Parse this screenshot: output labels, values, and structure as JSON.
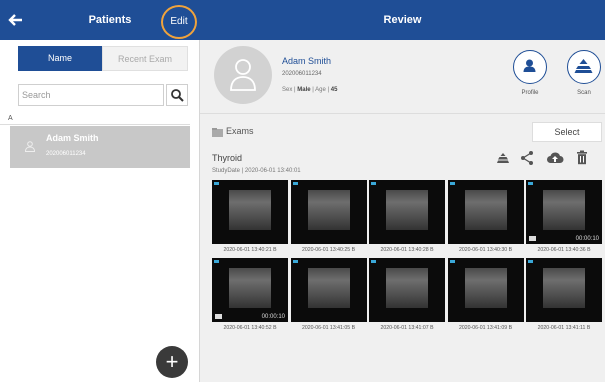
{
  "topbar": {
    "left_title": "Patients",
    "edit_label": "Edit",
    "right_title": "Review"
  },
  "left": {
    "tabs": [
      {
        "label": "Name",
        "active": true
      },
      {
        "label": "Recent Exam",
        "active": false
      }
    ],
    "search_placeholder": "Search",
    "group_letter": "A",
    "patients": [
      {
        "name": "Adam Smith",
        "id": "202006011234",
        "selected": true
      }
    ]
  },
  "patient": {
    "name": "Adam Smith",
    "id": "202006011234",
    "sex_label": "Sex",
    "sex": "Male",
    "age_label": "Age",
    "age": "45",
    "profile_label": "Profile",
    "scan_label": "Scan"
  },
  "exams": {
    "label": "Exams",
    "select_label": "Select",
    "study_title": "Thyroid",
    "study_date": "StudyDate | 2020-06-01 13:40:01",
    "images": [
      {
        "caption": "2020-06-01 13:40:21 B",
        "video": false,
        "duration": ""
      },
      {
        "caption": "2020-06-01 13:40:25 B",
        "video": false,
        "duration": ""
      },
      {
        "caption": "2020-06-01 13:40:28 B",
        "video": false,
        "duration": ""
      },
      {
        "caption": "2020-06-01 13:40:30 B",
        "video": false,
        "duration": ""
      },
      {
        "caption": "2020-06-01 13:40:36 B",
        "video": true,
        "duration": "00:00:10"
      },
      {
        "caption": "2020-06-01 13:40:52 B",
        "video": true,
        "duration": "00:00:10"
      },
      {
        "caption": "2020-06-01 13:41:05 B",
        "video": false,
        "duration": ""
      },
      {
        "caption": "2020-06-01 13:41:07 B",
        "video": false,
        "duration": ""
      },
      {
        "caption": "2020-06-01 13:41:09 B",
        "video": false,
        "duration": ""
      },
      {
        "caption": "2020-06-01 13:41:11 B",
        "video": false,
        "duration": ""
      }
    ]
  },
  "colors": {
    "brand": "#1f4e96",
    "highlight": "#f0a33c"
  },
  "icons": [
    "back-arrow-icon",
    "search-icon",
    "user-icon",
    "profile-icon",
    "scan-icon",
    "folder-icon",
    "scan-small-icon",
    "share-icon",
    "cloud-upload-icon",
    "trash-icon",
    "add-icon",
    "video-camera-icon"
  ]
}
